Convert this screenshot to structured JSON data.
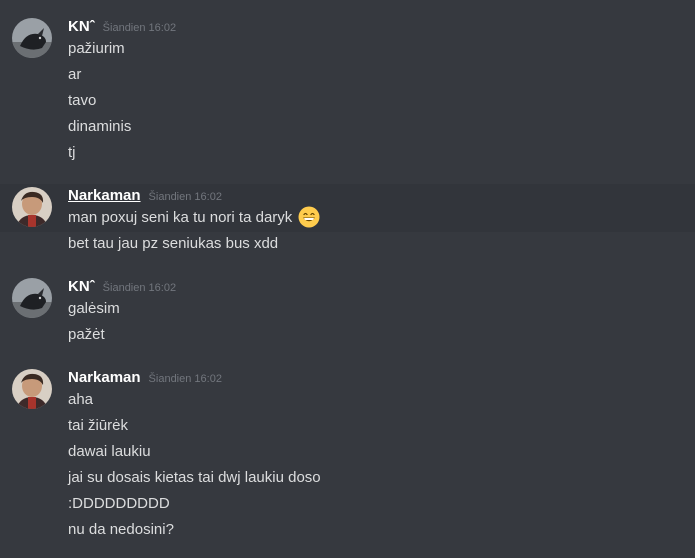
{
  "messages": [
    {
      "author": "KNˆ",
      "timestamp": "Šiandien 16:02",
      "lines": [
        "pažiurim",
        "ar",
        "tavo",
        "dinaminis",
        "tj"
      ]
    },
    {
      "author": "Narkaman",
      "timestamp": "Šiandien 16:02",
      "lines": [
        "man poxuj seni ka tu nori ta daryk",
        "bet tau jau pz seniukas bus xdd"
      ],
      "emoji": "grinning-face-emoji"
    },
    {
      "author": "KNˆ",
      "timestamp": "Šiandien 16:02",
      "lines": [
        "galėsim",
        "pažėt"
      ]
    },
    {
      "author": "Narkaman",
      "timestamp": "Šiandien 16:02",
      "lines": [
        "aha",
        "tai žiūrėk",
        "dawai laukiu",
        "jai su dosais kietas tai dwj laukiu doso",
        ":DDDDDDDDD",
        "nu da nedosini?"
      ]
    }
  ],
  "colors": {
    "background": "#36393f",
    "hover_background": "#32353b",
    "author": "#ffffff",
    "timestamp": "#72767d",
    "text": "#dcddde"
  }
}
